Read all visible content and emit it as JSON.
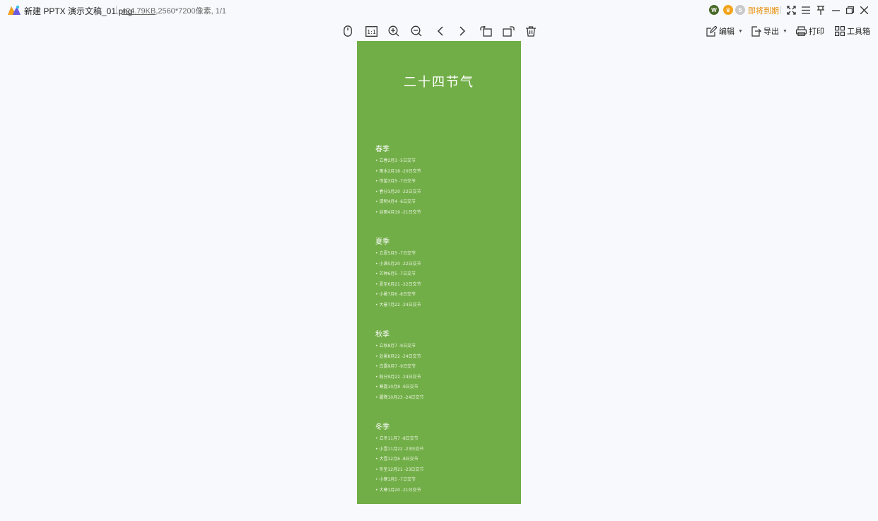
{
  "window": {
    "file_name": "新建 PPTX 演示文稿_01.png",
    "file_size": "424.79KB",
    "dimensions": ",2560*7200像素",
    "page_index": ", 1/1",
    "membership_text": "即将到期"
  },
  "toolbar": {
    "edit_label": "编辑",
    "export_label": "导出",
    "print_label": "打印",
    "toolbox_label": "工具箱",
    "actual_size_label": "1:1"
  },
  "image": {
    "title": "二十四节气",
    "seasons": [
      {
        "name": "春季",
        "terms": [
          "• 立春2月3 -5日交节",
          "• 雨水2月18 -20日交节",
          "• 惊蛰3月5 -7日交节",
          "• 春分3月20 -22日交节",
          "• 清明4月4 -6日交节",
          "• 谷雨4月19 -21日交节"
        ]
      },
      {
        "name": "夏季",
        "terms": [
          "• 立夏5月5 -7日交节",
          "• 小满5月20 -22日交节",
          "• 芒种6月5 -7日交节",
          "• 夏至6月21 -22日交节",
          "• 小暑7月6 -8日交节",
          "• 大暑7月22 -24日交节"
        ]
      },
      {
        "name": "秋季",
        "terms": [
          "• 立秋8月7 -9日交节",
          "• 处暑8月22 -24日交节",
          "• 白露9月7 -9日交节",
          "• 秋分9月22 -24日交节",
          "• 寒露10月8 -9日交节",
          "• 霜降10月23 -24日交节"
        ]
      },
      {
        "name": "冬季",
        "terms": [
          "• 立冬11月7 -8日交节",
          "• 小雪11月22 -23日交节",
          "• 大雪12月6 -8日交节",
          "• 冬至12月21 -23日交节",
          "• 小寒1月5 -7日交节",
          "• 大寒1月20 -21日交节"
        ]
      }
    ]
  },
  "colors": {
    "image_background": "#72ae48",
    "accent_orange": "#e58a00"
  }
}
